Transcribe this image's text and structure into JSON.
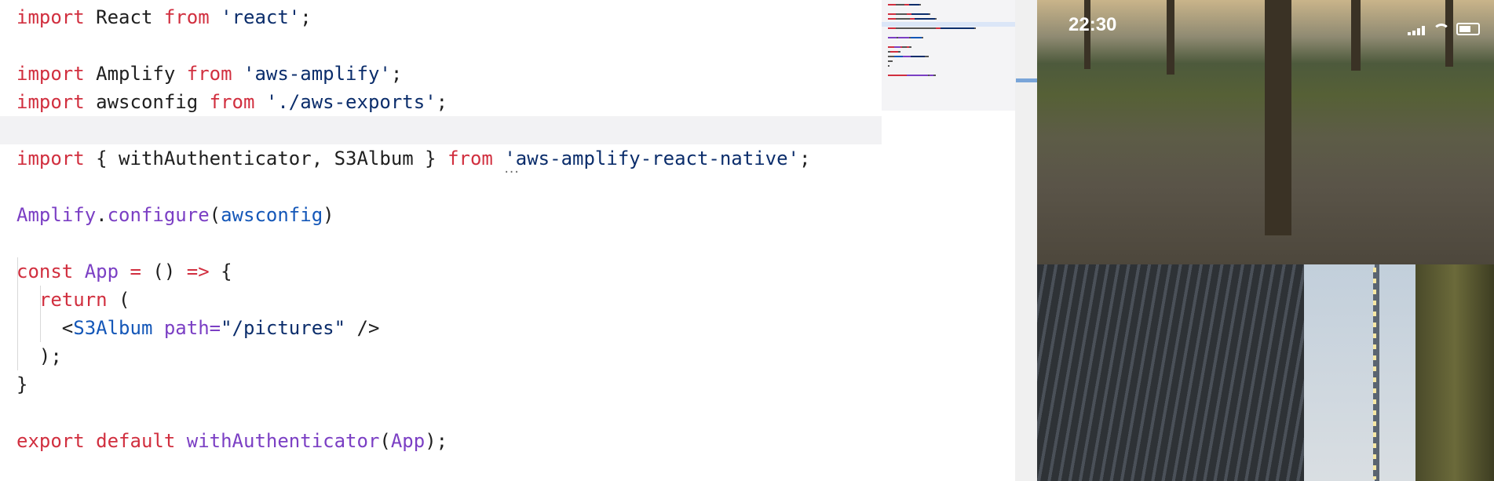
{
  "editor": {
    "lines": [
      [
        {
          "t": "import",
          "c": "kw"
        },
        {
          "t": " React ",
          "c": "plain"
        },
        {
          "t": "from",
          "c": "kw"
        },
        {
          "t": " 'react'",
          "c": "str"
        },
        {
          "t": ";",
          "c": "plain"
        }
      ],
      [],
      [
        {
          "t": "import",
          "c": "kw"
        },
        {
          "t": " Amplify ",
          "c": "plain"
        },
        {
          "t": "from",
          "c": "kw"
        },
        {
          "t": " 'aws-amplify'",
          "c": "str"
        },
        {
          "t": ";",
          "c": "plain"
        }
      ],
      [
        {
          "t": "import",
          "c": "kw"
        },
        {
          "t": " awsconfig ",
          "c": "plain"
        },
        {
          "t": "from",
          "c": "kw"
        },
        {
          "t": " './aws-exports'",
          "c": "str"
        },
        {
          "t": ";",
          "c": "plain"
        }
      ],
      [],
      [
        {
          "t": "import",
          "c": "kw"
        },
        {
          "t": " { withAuthenticator, S3Album } ",
          "c": "plain"
        },
        {
          "t": "from",
          "c": "kw"
        },
        {
          "t": " 'aws-amplify-react-native'",
          "c": "str"
        },
        {
          "t": ";",
          "c": "plain"
        }
      ],
      [],
      [
        {
          "t": "Amplify",
          "c": "fn"
        },
        {
          "t": ".",
          "c": "plain"
        },
        {
          "t": "configure",
          "c": "fn"
        },
        {
          "t": "(",
          "c": "plain"
        },
        {
          "t": "awsconfig",
          "c": "ident"
        },
        {
          "t": ")",
          "c": "plain"
        }
      ],
      [],
      [
        {
          "t": "const",
          "c": "kw"
        },
        {
          "t": " App ",
          "c": "fn"
        },
        {
          "t": "=",
          "c": "kw"
        },
        {
          "t": " () ",
          "c": "plain"
        },
        {
          "t": "=>",
          "c": "kw"
        },
        {
          "t": " {",
          "c": "plain"
        }
      ],
      [
        {
          "t": "  ",
          "c": "plain"
        },
        {
          "t": "return",
          "c": "kw"
        },
        {
          "t": " (",
          "c": "plain"
        }
      ],
      [
        {
          "t": "    <",
          "c": "plain"
        },
        {
          "t": "S3Album",
          "c": "ident"
        },
        {
          "t": " path=",
          "c": "fn"
        },
        {
          "t": "\"/pictures\"",
          "c": "str"
        },
        {
          "t": " />",
          "c": "plain"
        }
      ],
      [
        {
          "t": "  );",
          "c": "plain"
        }
      ],
      [
        {
          "t": "}",
          "c": "plain"
        }
      ],
      [],
      [
        {
          "t": "export",
          "c": "kw"
        },
        {
          "t": " default ",
          "c": "kw"
        },
        {
          "t": "withAuthenticator",
          "c": "fn"
        },
        {
          "t": "(",
          "c": "plain"
        },
        {
          "t": "App",
          "c": "fn"
        },
        {
          "t": ");",
          "c": "plain"
        }
      ]
    ],
    "current_line": 4
  },
  "phone": {
    "time": "22:30"
  },
  "colors": {
    "keyword": "#d12f3f",
    "string": "#0b2d6b",
    "function": "#7b3fc4",
    "identifier": "#1457b8"
  }
}
